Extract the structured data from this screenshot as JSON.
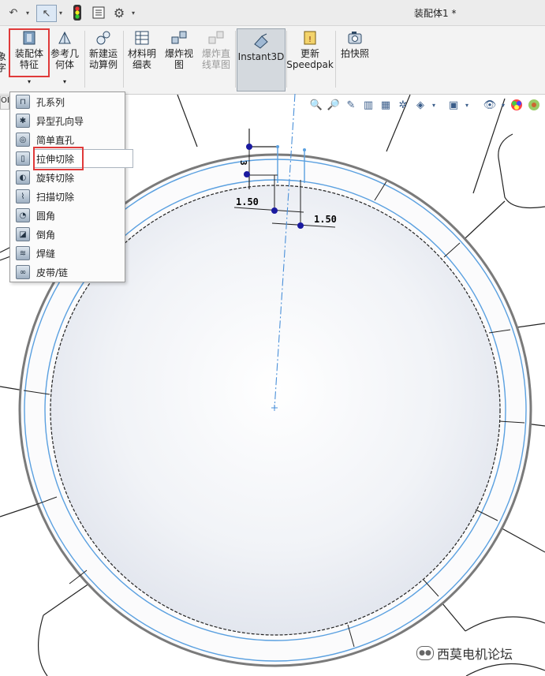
{
  "app": {
    "document_title": "装配体1 *"
  },
  "ribbon": {
    "buttons": [
      {
        "label_line1": "装配体",
        "label_line2": "特征",
        "state": "highlighted"
      },
      {
        "label_line1": "参考几",
        "label_line2": "何体"
      },
      {
        "label_line1": "新建运",
        "label_line2": "动算例"
      },
      {
        "label_line1": "材料明",
        "label_line2": "细表"
      },
      {
        "label_line1": "爆炸视",
        "label_line2": "图"
      },
      {
        "label_line1": "爆炸直",
        "label_line2": "线草图",
        "state": "disabled"
      },
      {
        "label_line1": "Instant3D",
        "label_line2": "",
        "state": "pressed"
      },
      {
        "label_line1": "更新",
        "label_line2": "Speedpak"
      },
      {
        "label_line1": "拍快照",
        "label_line2": ""
      }
    ],
    "left_cut_label": "象",
    "left_cut_label2": "字"
  },
  "feature_tree_stub": "OL",
  "menu": {
    "items": [
      {
        "label": "孔系列"
      },
      {
        "label": "异型孔向导"
      },
      {
        "label": "简单直孔"
      },
      {
        "label": "拉伸切除",
        "state": "highlighted"
      },
      {
        "label": "旋转切除"
      },
      {
        "label": "扫描切除"
      },
      {
        "label": "圆角"
      },
      {
        "label": "倒角"
      },
      {
        "label": "焊缝"
      },
      {
        "label": "皮带/链"
      }
    ]
  },
  "sketch": {
    "dimensions": [
      "3",
      "1.50",
      "1.50"
    ]
  },
  "colors": {
    "highlight_red": "#e03a3a",
    "sketch_blue": "#4a90d9",
    "point_blue": "#1a1aa0"
  },
  "watermark": {
    "text": "西莫电机论坛"
  }
}
